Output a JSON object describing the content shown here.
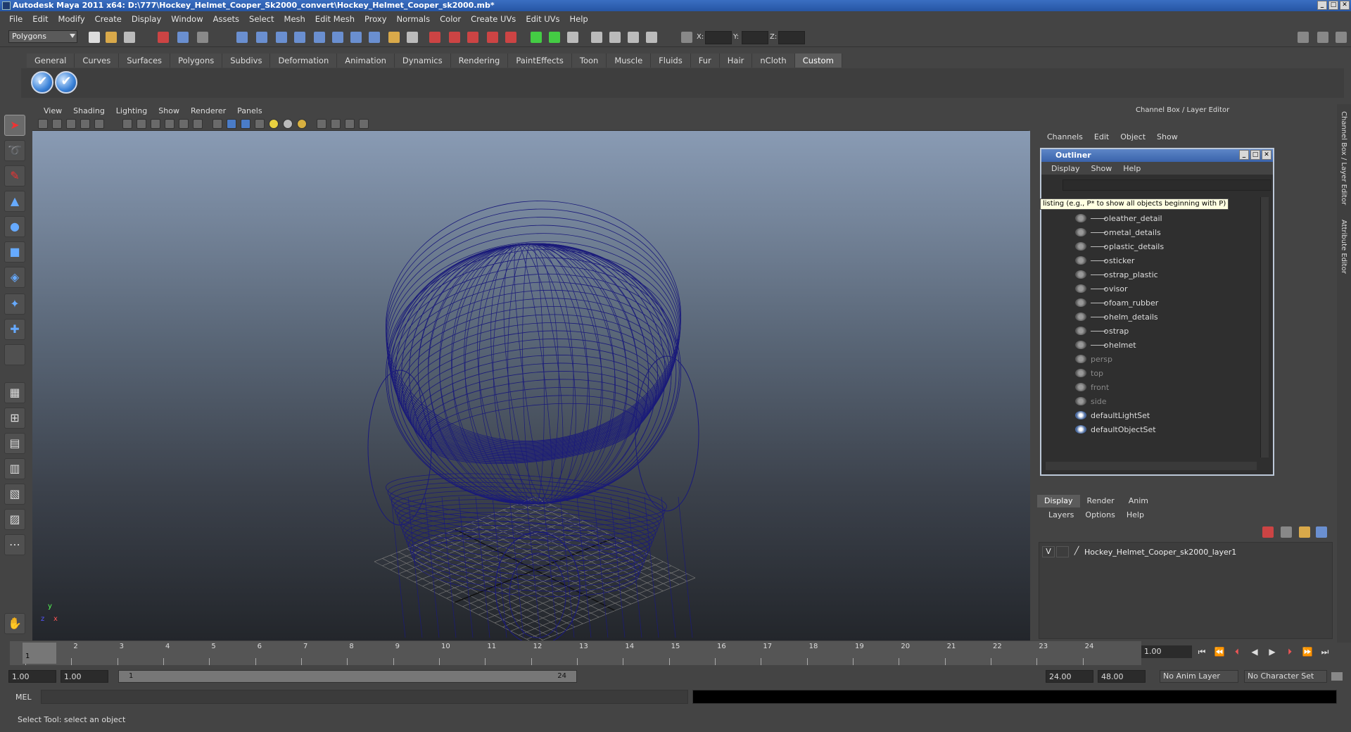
{
  "window": {
    "title": "Autodesk Maya 2011 x64: D:\\777\\Hockey_Helmet_Cooper_Sk2000_convert\\Hockey_Helmet_Cooper_sk2000.mb*",
    "min": "_",
    "max": "□",
    "close": "✕"
  },
  "menubar": [
    "File",
    "Edit",
    "Modify",
    "Create",
    "Display",
    "Window",
    "Assets",
    "Select",
    "Mesh",
    "Edit Mesh",
    "Proxy",
    "Normals",
    "Color",
    "Create UVs",
    "Edit UVs",
    "Help"
  ],
  "statusline": {
    "mode": "Polygons",
    "x_label": "X:",
    "y_label": "Y:",
    "z_label": "Z:"
  },
  "shelf": {
    "tabs": [
      "General",
      "Curves",
      "Surfaces",
      "Polygons",
      "Subdivs",
      "Deformation",
      "Animation",
      "Dynamics",
      "Rendering",
      "PaintEffects",
      "Toon",
      "Muscle",
      "Fluids",
      "Fur",
      "Hair",
      "nCloth",
      "Custom"
    ],
    "active": "Custom",
    "button_glyph": "✔"
  },
  "viewport": {
    "menus": [
      "View",
      "Shading",
      "Lighting",
      "Show",
      "Renderer",
      "Panels"
    ],
    "axis_y": "y",
    "axis_x": "x",
    "axis_z": "z",
    "wire_color": "#1a1a7a"
  },
  "channelbox": {
    "header": "Channel Box / Layer Editor",
    "menus": [
      "Channels",
      "Edit",
      "Object",
      "Show"
    ]
  },
  "outliner": {
    "title": "Outliner",
    "menus": [
      "Display",
      "Show",
      "Help"
    ],
    "tooltip": "listing (e.g., P* to show all objects beginning with P)",
    "children": [
      "leather_detail",
      "metal_details",
      "plastic_details",
      "sticker",
      "strap_plastic",
      "visor",
      "foam_rubber",
      "helm_details",
      "strap",
      "helmet"
    ],
    "cameras": [
      "persp",
      "top",
      "front",
      "side"
    ],
    "sets": [
      "defaultLightSet",
      "defaultObjectSet"
    ]
  },
  "layers": {
    "tabs": [
      "Display",
      "Render",
      "Anim"
    ],
    "active": "Display",
    "menus": [
      "Layers",
      "Options",
      "Help"
    ],
    "row": {
      "vis": "V",
      "name": "Hockey_Helmet_Cooper_sk2000_layer1"
    }
  },
  "rightstrip": {
    "cb": "Channel Box / Layer Editor",
    "ae": "Attribute Editor"
  },
  "timeline": {
    "ticks": [
      "1",
      "2",
      "3",
      "4",
      "5",
      "6",
      "7",
      "8",
      "9",
      "10",
      "11",
      "12",
      "13",
      "14",
      "15",
      "16",
      "17",
      "18",
      "19",
      "20",
      "21",
      "22",
      "23",
      "24"
    ],
    "current_marker": "1",
    "current_frame": "1.00"
  },
  "playback": [
    "⏮",
    "⏪",
    "⏴",
    "◀",
    "▶",
    "⏵",
    "⏩",
    "⏭"
  ],
  "range": {
    "start": "1.00",
    "start2": "1.00",
    "slider_start": "1",
    "slider_end": "24",
    "end": "24.00",
    "end2": "48.00",
    "anim_layer": "No Anim Layer",
    "char_set": "No Character Set"
  },
  "cmdline": {
    "label": "MEL"
  },
  "helpline": {
    "text": "Select Tool: select an object"
  }
}
